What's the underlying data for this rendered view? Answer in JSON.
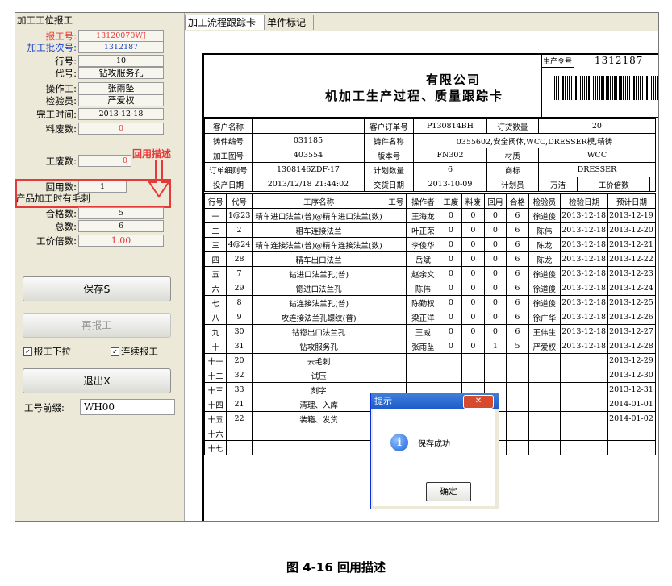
{
  "left": {
    "title": "加工工位报工",
    "fields": [
      {
        "label": "报工号:",
        "value": "13120070WJ",
        "red": true
      },
      {
        "label": "加工批次号:",
        "value": "1312187",
        "blue": true
      },
      {
        "label": "行号:",
        "value": "10"
      },
      {
        "label": "代号:",
        "value": "钻攻服务孔"
      },
      {
        "label": "操作工:",
        "value": "张雨坠"
      },
      {
        "label": "检验员:",
        "value": "严爱权"
      },
      {
        "label": "完工时间:",
        "value": "2013-12-18"
      },
      {
        "label": "料废数:",
        "value": "0",
        "redval": true
      }
    ],
    "gong_fei_label": "工废数:",
    "gong_fei_value": "0",
    "annotation": "回用描述",
    "huiyong_label": "回用数:",
    "huiyong_value": "1",
    "huiyong_desc": "产品加工时有毛刺",
    "hege_label": "合格数:",
    "hege_value": "5",
    "zong_label": "总数:",
    "zong_value": "6",
    "beishu_label": "工价倍数:",
    "beishu_value": "1.00",
    "save_button": "保存S",
    "rebaogong_button": "再报工",
    "check_baogong": "报工下拉",
    "check_lianxu": "连续报工",
    "exit_button": "退出X",
    "prefix_label": "工号前缀:",
    "prefix_value": "WH00"
  },
  "tabs": [
    "加工流程跟踪卡",
    "单件标记"
  ],
  "card": {
    "company": "有限公司",
    "title": "机加工生产过程、质量跟踪卡",
    "order_label": "生产令号",
    "order_value": "1312187",
    "info": {
      "r1": [
        "客户名称",
        "",
        "客户订单号",
        "P130814BH",
        "订货数量",
        "20"
      ],
      "r2": [
        "铸件编号",
        "031185",
        "铸件名称",
        "0355602,安全阀体,WCC,DRESSER模,精铸"
      ],
      "r3": [
        "加工图号",
        "403554",
        "版本号",
        "FN302",
        "材质",
        "WCC"
      ],
      "r4": [
        "订单细则号",
        "1308146ZDF-17",
        "计划数量",
        "6",
        "商标",
        "DRESSER"
      ],
      "r5": [
        "投产日期",
        "2013/12/18 21:44:02",
        "交货日期",
        "2013-10-09",
        "计划员",
        "万洁",
        "工价倍数",
        ""
      ]
    },
    "headers": [
      "行号",
      "代号",
      "工序名称",
      "工号",
      "操作者",
      "工废",
      "料废",
      "回用",
      "合格",
      "检验员",
      "检验日期",
      "预计日期"
    ],
    "rows": [
      [
        "一",
        "1@23",
        "精车进口法兰(普)@精车进口法兰(数)",
        "",
        "王海龙",
        "0",
        "0",
        "0",
        "6",
        "徐道俊",
        "2013-12-18",
        "2013-12-19"
      ],
      [
        "二",
        "2",
        "粗车连接法兰",
        "",
        "叶正荣",
        "0",
        "0",
        "0",
        "6",
        "陈伟",
        "2013-12-18",
        "2013-12-20"
      ],
      [
        "三",
        "4@24",
        "精车连接法兰(普)@精车连接法兰(数)",
        "",
        "李俊华",
        "0",
        "0",
        "0",
        "6",
        "陈龙",
        "2013-12-18",
        "2013-12-21"
      ],
      [
        "四",
        "28",
        "精车出口法兰",
        "",
        "岳斌",
        "0",
        "0",
        "0",
        "6",
        "陈龙",
        "2013-12-18",
        "2013-12-22"
      ],
      [
        "五",
        "7",
        "钻进口法兰孔(普)",
        "",
        "赵余文",
        "0",
        "0",
        "0",
        "6",
        "徐道俊",
        "2013-12-18",
        "2013-12-23"
      ],
      [
        "六",
        "29",
        "锪进口法兰孔",
        "",
        "陈伟",
        "0",
        "0",
        "0",
        "6",
        "徐道俊",
        "2013-12-18",
        "2013-12-24"
      ],
      [
        "七",
        "8",
        "钻连接法兰孔(普)",
        "",
        "陈勤权",
        "0",
        "0",
        "0",
        "6",
        "徐道俊",
        "2013-12-18",
        "2013-12-25"
      ],
      [
        "八",
        "9",
        "攻连接法兰孔螺纹(普)",
        "",
        "梁正洋",
        "0",
        "0",
        "0",
        "6",
        "徐广华",
        "2013-12-18",
        "2013-12-26"
      ],
      [
        "九",
        "30",
        "钻锪出口法兰孔",
        "",
        "王威",
        "0",
        "0",
        "0",
        "6",
        "王伟生",
        "2013-12-18",
        "2013-12-27"
      ],
      [
        "十",
        "31",
        "钻攻服务孔",
        "",
        "张雨坠",
        "0",
        "0",
        "1",
        "5",
        "严爱权",
        "2013-12-18",
        "2013-12-28"
      ],
      [
        "十一",
        "20",
        "去毛刺",
        "",
        "",
        "",
        "",
        "",
        "",
        "",
        "",
        "2013-12-29"
      ],
      [
        "十二",
        "32",
        "试压",
        "",
        "",
        "",
        "",
        "",
        "",
        "",
        "",
        "2013-12-30"
      ],
      [
        "十三",
        "33",
        "刻字",
        "",
        "",
        "",
        "",
        "",
        "",
        "",
        "",
        "2013-12-31"
      ],
      [
        "十四",
        "21",
        "清理、入库",
        "",
        "",
        "",
        "",
        "",
        "",
        "",
        "",
        "2014-01-01"
      ],
      [
        "十五",
        "22",
        "装箱、发货",
        "",
        "",
        "",
        "",
        "",
        "",
        "",
        "",
        "2014-01-02"
      ],
      [
        "十六",
        "",
        "",
        "",
        "",
        "",
        "",
        "",
        "",
        "",
        "",
        ""
      ],
      [
        "十七",
        "",
        "",
        "",
        "",
        "",
        "",
        "",
        "",
        "",
        "",
        ""
      ]
    ]
  },
  "dialog": {
    "title": "提示",
    "message": "保存成功",
    "ok": "确定"
  },
  "caption": "图 4-16  回用描述"
}
